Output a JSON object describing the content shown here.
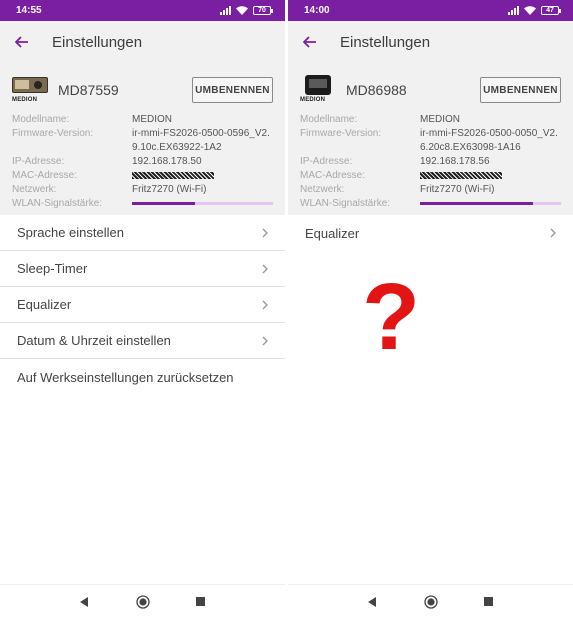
{
  "colors": {
    "accent": "#7b1fa2",
    "question_mark": "#e31414"
  },
  "left": {
    "status": {
      "time": "14:55",
      "battery": "70"
    },
    "appbar": {
      "title": "Einstellungen"
    },
    "device": {
      "name": "MD87559",
      "logo_text": "MEDION",
      "rename_label": "UMBENENNEN",
      "info": [
        {
          "label": "Modellname:",
          "value": "MEDION"
        },
        {
          "label": "Firmware-Version:",
          "value": "ir-mmi-FS2026-0500-0596_V2.9.10c.EX63922-1A2"
        },
        {
          "label": "IP-Adresse:",
          "value": "192.168.178.50"
        },
        {
          "label": "MAC-Adresse:",
          "value": ""
        },
        {
          "label": "Netzwerk:",
          "value": "Fritz7270 (Wi-Fi)"
        },
        {
          "label": "WLAN-Signalstärke:",
          "value": ""
        }
      ],
      "signal_fraction": 0.45
    },
    "menu": [
      {
        "label": "Sprache einstellen"
      },
      {
        "label": "Sleep-Timer"
      },
      {
        "label": "Equalizer"
      },
      {
        "label": "Datum & Uhrzeit einstellen"
      },
      {
        "label": "Auf Werkseinstellungen zurücksetzen"
      }
    ]
  },
  "right": {
    "status": {
      "time": "14:00",
      "battery": "47"
    },
    "appbar": {
      "title": "Einstellungen"
    },
    "device": {
      "name": "MD86988",
      "logo_text": "MEDION",
      "rename_label": "UMBENENNEN",
      "info": [
        {
          "label": "Modellname:",
          "value": "MEDION"
        },
        {
          "label": "Firmware-Version:",
          "value": "ir-mmi-FS2026-0500-0050_V2.6.20c8.EX63098-1A16"
        },
        {
          "label": "IP-Adresse:",
          "value": "192.168.178.56"
        },
        {
          "label": "MAC-Adresse:",
          "value": ""
        },
        {
          "label": "Netzwerk:",
          "value": "Fritz7270 (Wi-Fi)"
        },
        {
          "label": "WLAN-Signalstärke:",
          "value": ""
        }
      ],
      "signal_fraction": 0.8
    },
    "menu": [
      {
        "label": "Equalizer"
      }
    ],
    "annotation": "?"
  }
}
